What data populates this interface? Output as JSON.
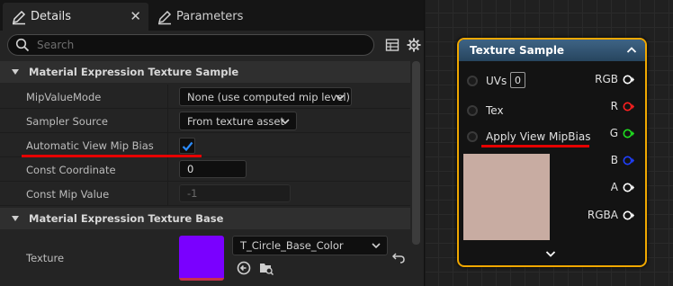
{
  "tabs": [
    {
      "label": "Details",
      "active": true,
      "icon": "pencil-icon"
    },
    {
      "label": "Parameters",
      "active": false,
      "icon": "pencil-icon"
    }
  ],
  "tab_close_glyph": "✕",
  "search": {
    "placeholder": "Search",
    "value": ""
  },
  "sections": [
    {
      "label": "Material Expression Texture Sample"
    },
    {
      "label": "Material Expression Texture Base"
    }
  ],
  "properties": {
    "mip_value_mode": {
      "label": "MipValueMode",
      "value": "None (use computed mip level)"
    },
    "sampler_source": {
      "label": "Sampler Source",
      "value": "From texture asset"
    },
    "auto_view_mip_bias": {
      "label": "Automatic View Mip Bias",
      "checked": true
    },
    "const_coordinate": {
      "label": "Const Coordinate",
      "value": "0"
    },
    "const_mip_value": {
      "label": "Const Mip Value",
      "value": "-1"
    },
    "texture": {
      "label": "Texture",
      "value": "T_Circle_Base_Color",
      "thumbnail_color": "#7a00ff"
    }
  },
  "node": {
    "title": "Texture Sample",
    "inputs": [
      {
        "label": "UVs",
        "const_value": "0"
      },
      {
        "label": "Tex"
      },
      {
        "label": "Apply View MipBias"
      }
    ],
    "outputs": [
      {
        "label": "RGB",
        "color": "#ffffff"
      },
      {
        "label": "R",
        "color": "#ff2020"
      },
      {
        "label": "G",
        "color": "#20e020"
      },
      {
        "label": "B",
        "color": "#2040ff"
      },
      {
        "label": "A",
        "color": "#ffffff"
      },
      {
        "label": "RGBA",
        "color": "#ffffff"
      }
    ],
    "preview_color": "#c8aca2"
  },
  "colors": {
    "accent_checkbox": "#2b8cff",
    "annotation_underline": "#e60000",
    "node_border": "#f0a800"
  }
}
